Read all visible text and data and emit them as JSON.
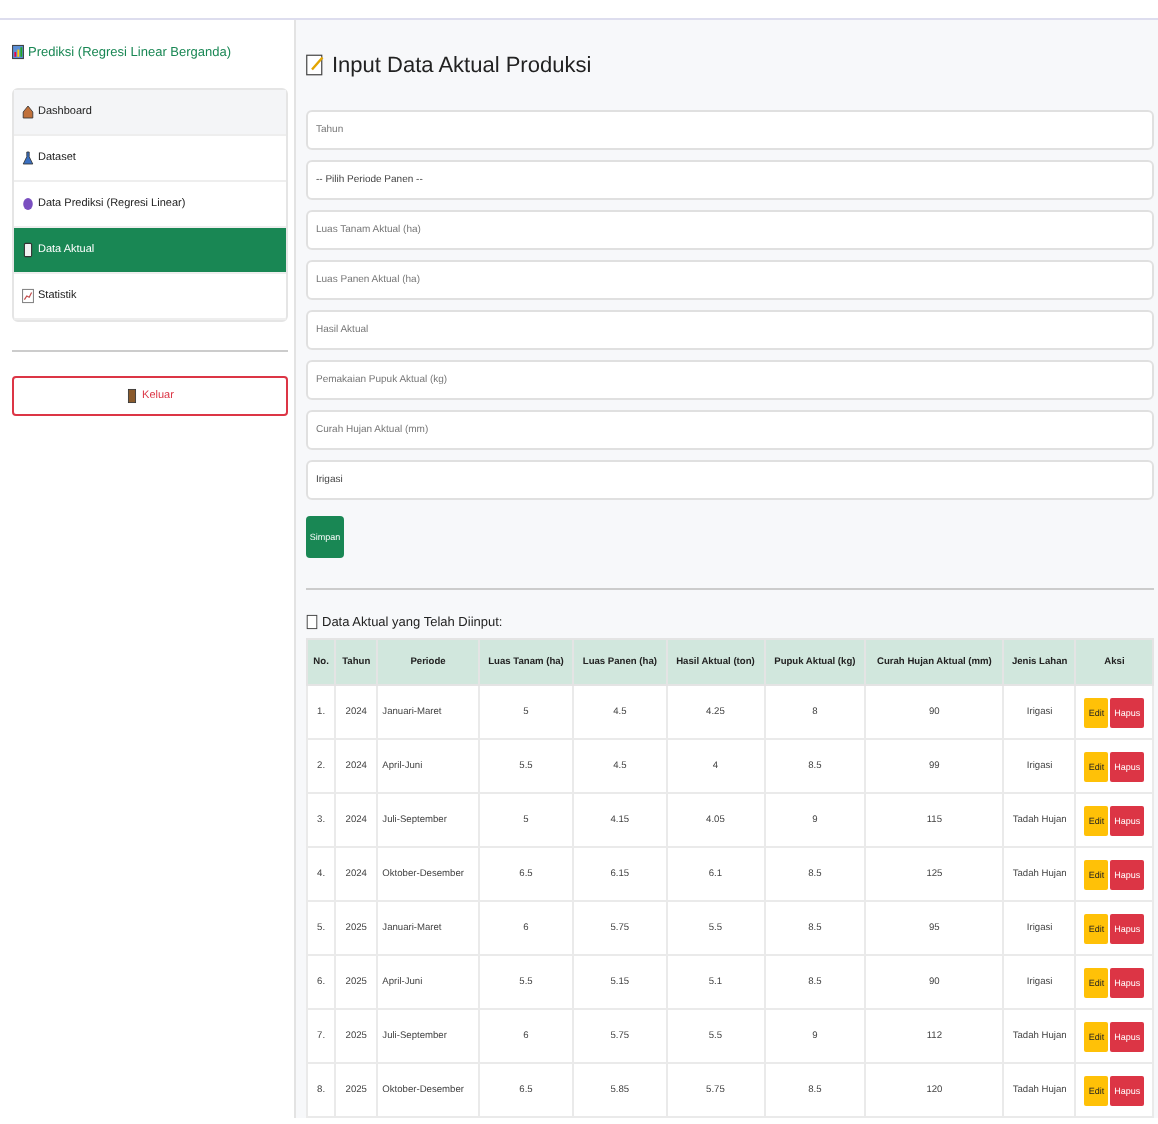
{
  "sidebar": {
    "title": "Prediksi (Regresi Linear Berganda)",
    "items": [
      {
        "label": "Dashboard",
        "kind": "home",
        "selected": false
      },
      {
        "label": "Dataset",
        "kind": "flask",
        "selected": false
      },
      {
        "label": "Data Prediksi (Regresi Linear)",
        "kind": "orb",
        "selected": false
      },
      {
        "label": "Data Aktual",
        "kind": "phone",
        "selected": true
      },
      {
        "label": "Statistik",
        "kind": "chart",
        "selected": false
      }
    ],
    "logout": "Keluar"
  },
  "form": {
    "title": "Input Data Aktual Produksi",
    "fields": [
      {
        "kind": "input",
        "placeholder": "Tahun"
      },
      {
        "kind": "select",
        "value": "-- Pilih Periode Panen --"
      },
      {
        "kind": "input",
        "placeholder": "Luas Tanam Aktual (ha)"
      },
      {
        "kind": "input",
        "placeholder": "Luas Panen Aktual (ha)"
      },
      {
        "kind": "input",
        "placeholder": "Hasil Aktual"
      },
      {
        "kind": "input",
        "placeholder": "Pemakaian Pupuk Aktual (kg)"
      },
      {
        "kind": "input",
        "placeholder": "Curah Hujan Aktual (mm)"
      },
      {
        "kind": "select",
        "value": "Irigasi"
      }
    ],
    "submit": "Simpan"
  },
  "table": {
    "title": "Data Aktual yang Telah Diinput:",
    "columns": [
      "No.",
      "Tahun",
      "Periode",
      "Luas Tanam (ha)",
      "Luas Panen (ha)",
      "Hasil Aktual (ton)",
      "Pupuk Aktual (kg)",
      "Curah Hujan Aktual (mm)",
      "Jenis Lahan",
      "Aksi"
    ],
    "rows": [
      {
        "cells": [
          "1.",
          "2024",
          "Januari-Maret",
          "5",
          "4.5",
          "4.25",
          "8",
          "90",
          "Irigasi"
        ],
        "edit": "Edit",
        "delete": "Hapus"
      },
      {
        "cells": [
          "2.",
          "2024",
          "April-Juni",
          "5.5",
          "4.5",
          "4",
          "8.5",
          "99",
          "Irigasi"
        ],
        "edit": "Edit",
        "delete": "Hapus"
      },
      {
        "cells": [
          "3.",
          "2024",
          "Juli-September",
          "5",
          "4.15",
          "4.05",
          "9",
          "115",
          "Tadah Hujan"
        ],
        "edit": "Edit",
        "delete": "Hapus"
      },
      {
        "cells": [
          "4.",
          "2024",
          "Oktober-Desember",
          "6.5",
          "6.15",
          "6.1",
          "8.5",
          "125",
          "Tadah Hujan"
        ],
        "edit": "Edit",
        "delete": "Hapus"
      },
      {
        "cells": [
          "5.",
          "2025",
          "Januari-Maret",
          "6",
          "5.75",
          "5.5",
          "8.5",
          "95",
          "Irigasi"
        ],
        "edit": "Edit",
        "delete": "Hapus"
      },
      {
        "cells": [
          "6.",
          "2025",
          "April-Juni",
          "5.5",
          "5.15",
          "5.1",
          "8.5",
          "90",
          "Irigasi"
        ],
        "edit": "Edit",
        "delete": "Hapus"
      },
      {
        "cells": [
          "7.",
          "2025",
          "Juli-September",
          "6",
          "5.75",
          "5.5",
          "9",
          "112",
          "Tadah Hujan"
        ],
        "edit": "Edit",
        "delete": "Hapus"
      },
      {
        "cells": [
          "8.",
          "2025",
          "Oktober-Desember",
          "6.5",
          "5.85",
          "5.75",
          "8.5",
          "120",
          "Tadah Hujan"
        ],
        "edit": "Edit",
        "delete": "Hapus"
      }
    ]
  }
}
